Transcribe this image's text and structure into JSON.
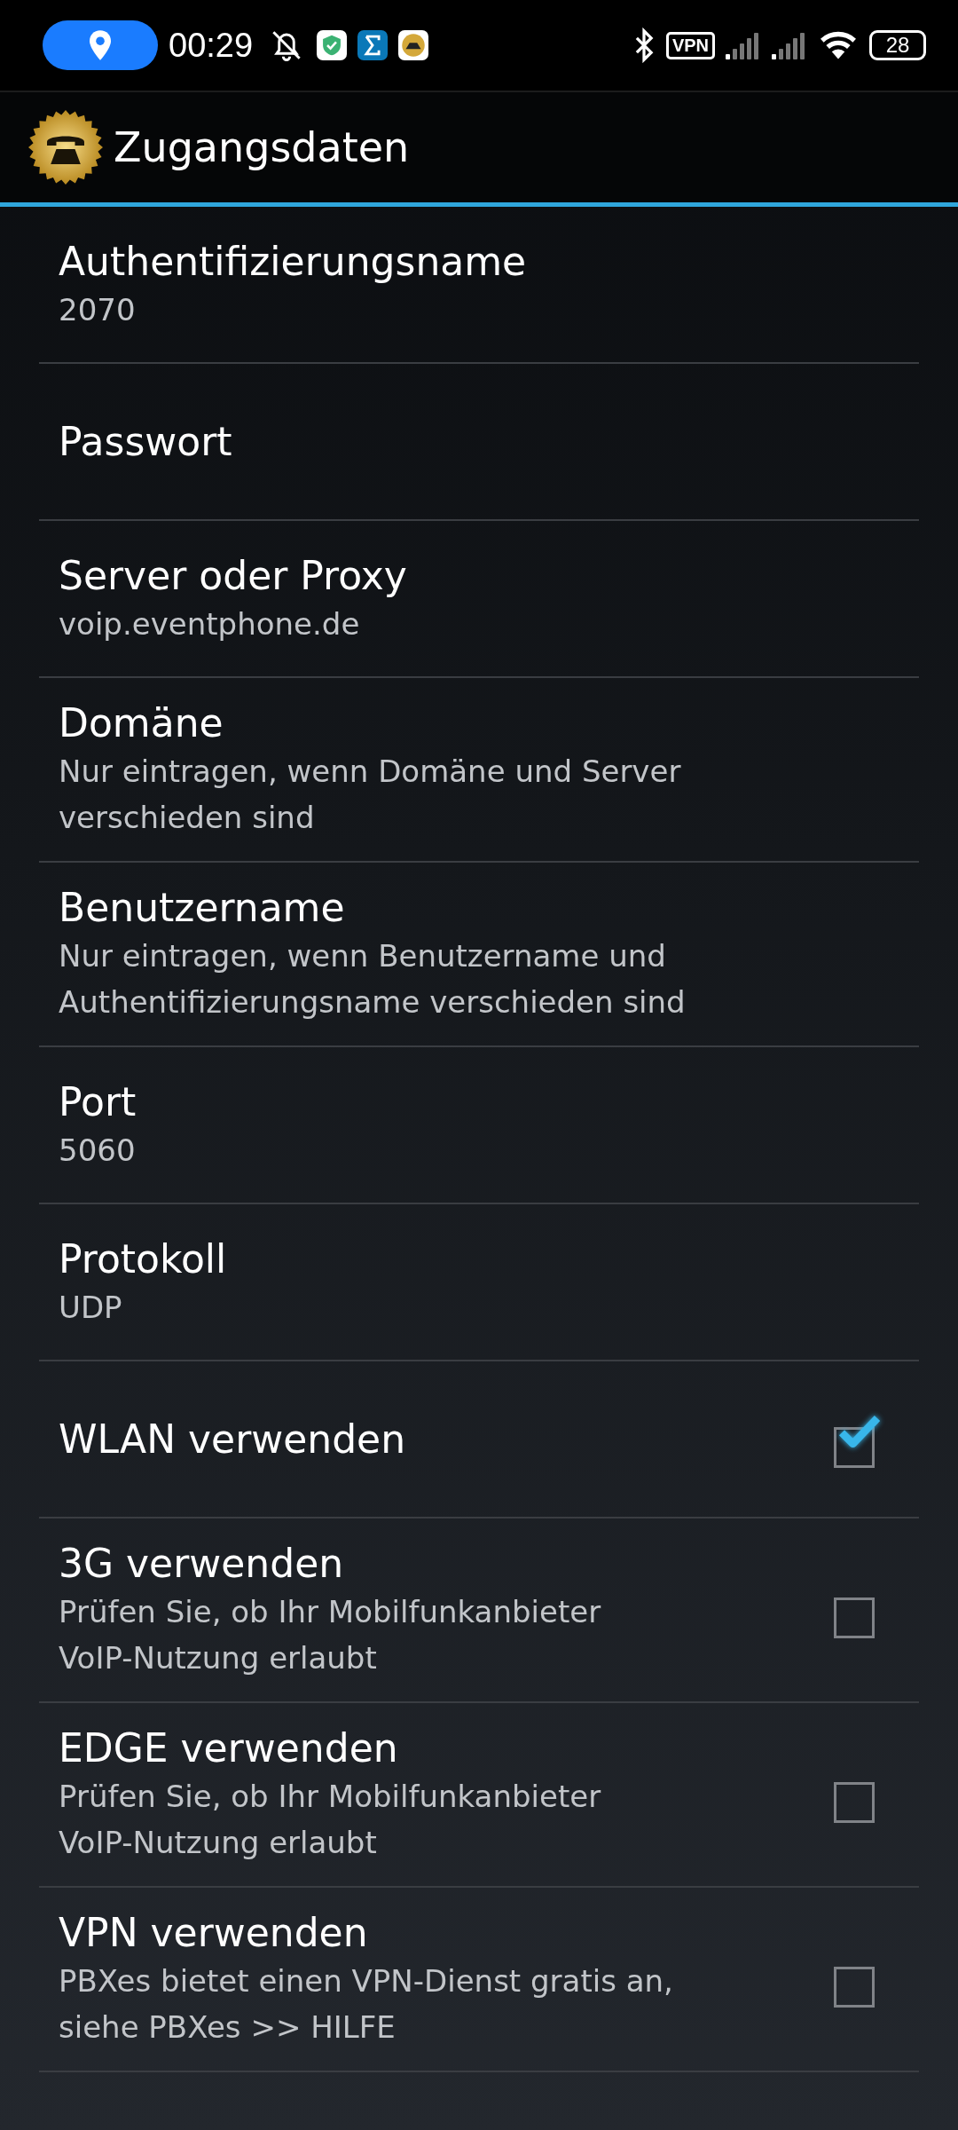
{
  "status_bar": {
    "time": "00:29",
    "vpn_label": "VPN",
    "battery": "28"
  },
  "header": {
    "title": "Zugangsdaten"
  },
  "settings": [
    {
      "kind": "text",
      "title": "Authentifizierungsname",
      "summary": "2070"
    },
    {
      "kind": "text",
      "title": "Passwort"
    },
    {
      "kind": "text",
      "title": "Server oder Proxy",
      "summary": "voip.eventphone.de"
    },
    {
      "kind": "text",
      "title": "Domäne",
      "summary": "Nur eintragen, wenn Domäne und Server verschieden sind"
    },
    {
      "kind": "text",
      "title": "Benutzername",
      "summary": "Nur eintragen, wenn Benutzername und Authentifizierungsname verschieden sind"
    },
    {
      "kind": "text",
      "title": "Port",
      "summary": "5060"
    },
    {
      "kind": "text",
      "title": "Protokoll",
      "summary": "UDP"
    },
    {
      "kind": "checkbox",
      "title": "WLAN verwenden",
      "checked": true
    },
    {
      "kind": "checkbox",
      "title": "3G verwenden",
      "summary": "Prüfen Sie, ob Ihr Mobilfunkanbieter VoIP-Nutzung erlaubt",
      "checked": false
    },
    {
      "kind": "checkbox",
      "title": "EDGE verwenden",
      "summary": "Prüfen Sie, ob Ihr Mobilfunkanbieter VoIP-Nutzung erlaubt",
      "checked": false
    },
    {
      "kind": "checkbox",
      "title": "VPN verwenden",
      "summary": "PBXes bietet einen VPN-Dienst gratis an, siehe PBXes >> HILFE",
      "checked": false
    }
  ]
}
